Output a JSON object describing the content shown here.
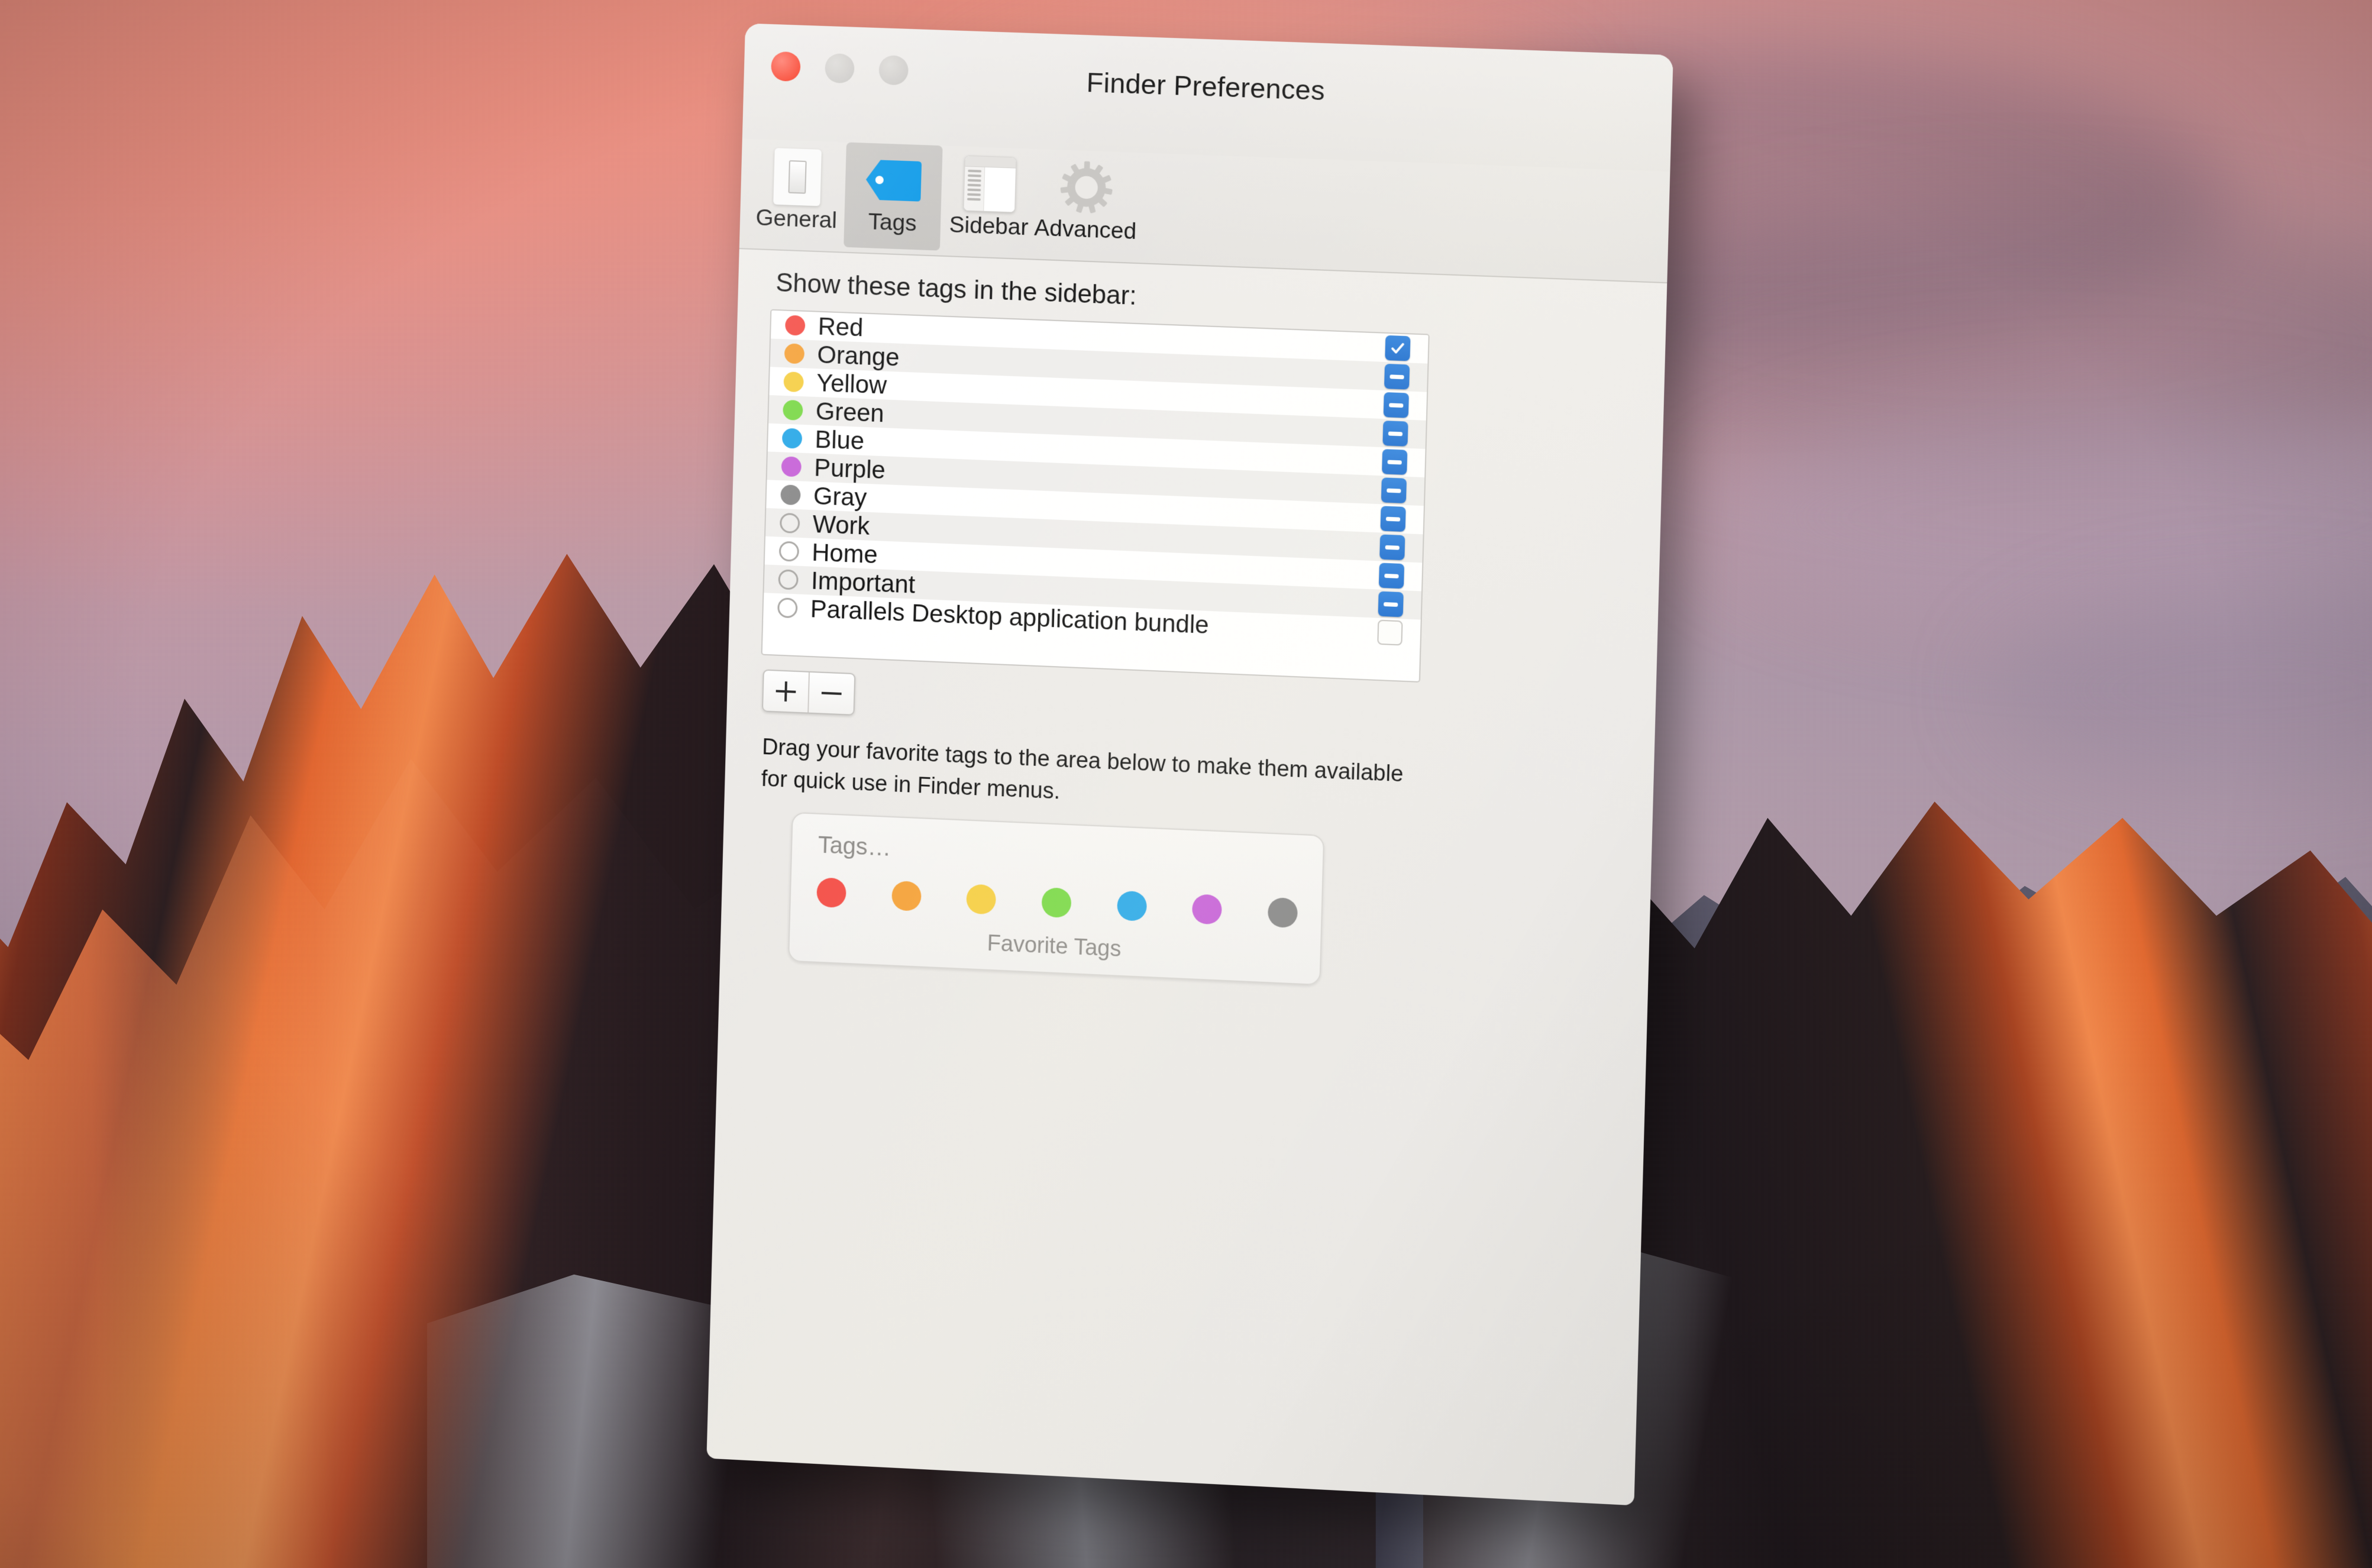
{
  "window": {
    "title": "Finder Preferences",
    "traffic_lights": {
      "close": "close-button",
      "minimize": "minimize-button",
      "zoom": "zoom-button"
    }
  },
  "toolbar": {
    "tabs": [
      {
        "label": "General",
        "icon": "light-switch-icon",
        "selected": false
      },
      {
        "label": "Tags",
        "icon": "blue-tag-icon",
        "selected": true
      },
      {
        "label": "Sidebar",
        "icon": "sidebar-window-icon",
        "selected": false
      },
      {
        "label": "Advanced",
        "icon": "gear-icon",
        "selected": false
      }
    ]
  },
  "main": {
    "section_label": "Show these tags in the sidebar:",
    "tags": [
      {
        "name": "Red",
        "color": "#f4514a",
        "hollow": false,
        "check": "on"
      },
      {
        "name": "Orange",
        "color": "#f5a33c",
        "hollow": false,
        "check": "mixed"
      },
      {
        "name": "Yellow",
        "color": "#f5cf46",
        "hollow": false,
        "check": "mixed"
      },
      {
        "name": "Green",
        "color": "#7cd94a",
        "hollow": false,
        "check": "mixed"
      },
      {
        "name": "Blue",
        "color": "#2ba9e8",
        "hollow": false,
        "check": "mixed"
      },
      {
        "name": "Purple",
        "color": "#c764d8",
        "hollow": false,
        "check": "mixed"
      },
      {
        "name": "Gray",
        "color": "#8b8b8b",
        "hollow": false,
        "check": "mixed"
      },
      {
        "name": "Work",
        "color": "",
        "hollow": true,
        "check": "mixed"
      },
      {
        "name": "Home",
        "color": "",
        "hollow": true,
        "check": "mixed"
      },
      {
        "name": "Important",
        "color": "",
        "hollow": true,
        "check": "mixed"
      },
      {
        "name": "Parallels Desktop application bundle",
        "color": "",
        "hollow": true,
        "check": "off"
      }
    ],
    "add_button_label": "+",
    "remove_button_label": "−",
    "hint_text": "Drag your favorite tags to the area below to make them available for quick use in Finder menus.",
    "favorites": {
      "placeholder_label": "Tags…",
      "caption": "Favorite Tags",
      "dots": [
        "#f4514a",
        "#f5a33c",
        "#f5cf46",
        "#7cd94a",
        "#2ba9e8",
        "#c764d8",
        "#8b8b8b"
      ]
    }
  },
  "colors": {
    "accent_blue": "#2f82de",
    "close_red": "#f8412c",
    "tag_icon_blue": "#0d9ae8",
    "window_bg": "#eceae7"
  }
}
